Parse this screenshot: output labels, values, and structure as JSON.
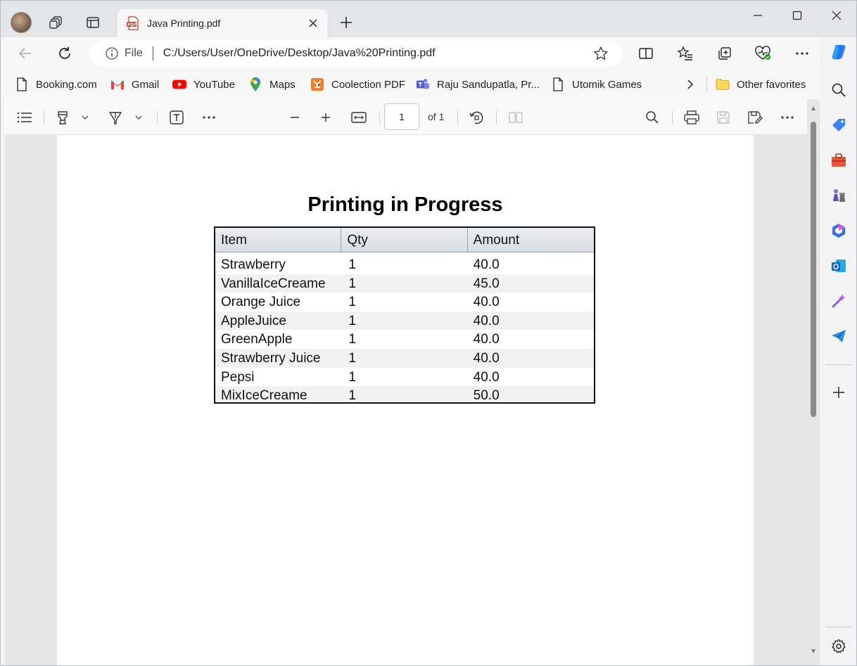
{
  "browser": {
    "tab": {
      "title": "Java Printing.pdf",
      "favicon_text": "PDF"
    },
    "address": {
      "scheme_label": "File",
      "url": "C:/Users/User/OneDrive/Desktop/Java%20Printing.pdf"
    },
    "favorites": [
      {
        "label": "Booking.com",
        "icon": "page-icon"
      },
      {
        "label": "Gmail",
        "icon": "gmail-icon"
      },
      {
        "label": "YouTube",
        "icon": "youtube-icon"
      },
      {
        "label": "Maps",
        "icon": "maps-pin-icon"
      },
      {
        "label": "Coolection PDF",
        "icon": "xampp-icon"
      },
      {
        "label": "Raju Sandupatla, Pr...",
        "icon": "teams-icon"
      },
      {
        "label": "Utomik Games",
        "icon": "page-icon"
      }
    ],
    "other_favorites": "Other favorites"
  },
  "pdf_toolbar": {
    "page_number": "1",
    "page_count": "of 1"
  },
  "document": {
    "title": "Printing in Progress",
    "columns": [
      "Item",
      "Qty",
      "Amount"
    ],
    "rows": [
      [
        "Strawberry",
        "1",
        "40.0"
      ],
      [
        "VanillaIceCreame",
        "1",
        "45.0"
      ],
      [
        "Orange Juice",
        "1",
        "40.0"
      ],
      [
        "AppleJuice",
        "1",
        "40.0"
      ],
      [
        "GreenApple",
        "1",
        "40.0"
      ],
      [
        "Strawberry Juice",
        "1",
        "40.0"
      ],
      [
        "Pepsi",
        "1",
        "40.0"
      ],
      [
        "MixIceCreame",
        "1",
        "50.0"
      ]
    ]
  },
  "colors": {
    "accent": "#0f6cbd",
    "pdf_badge": "#d93025",
    "youtube": "#ff0000"
  }
}
